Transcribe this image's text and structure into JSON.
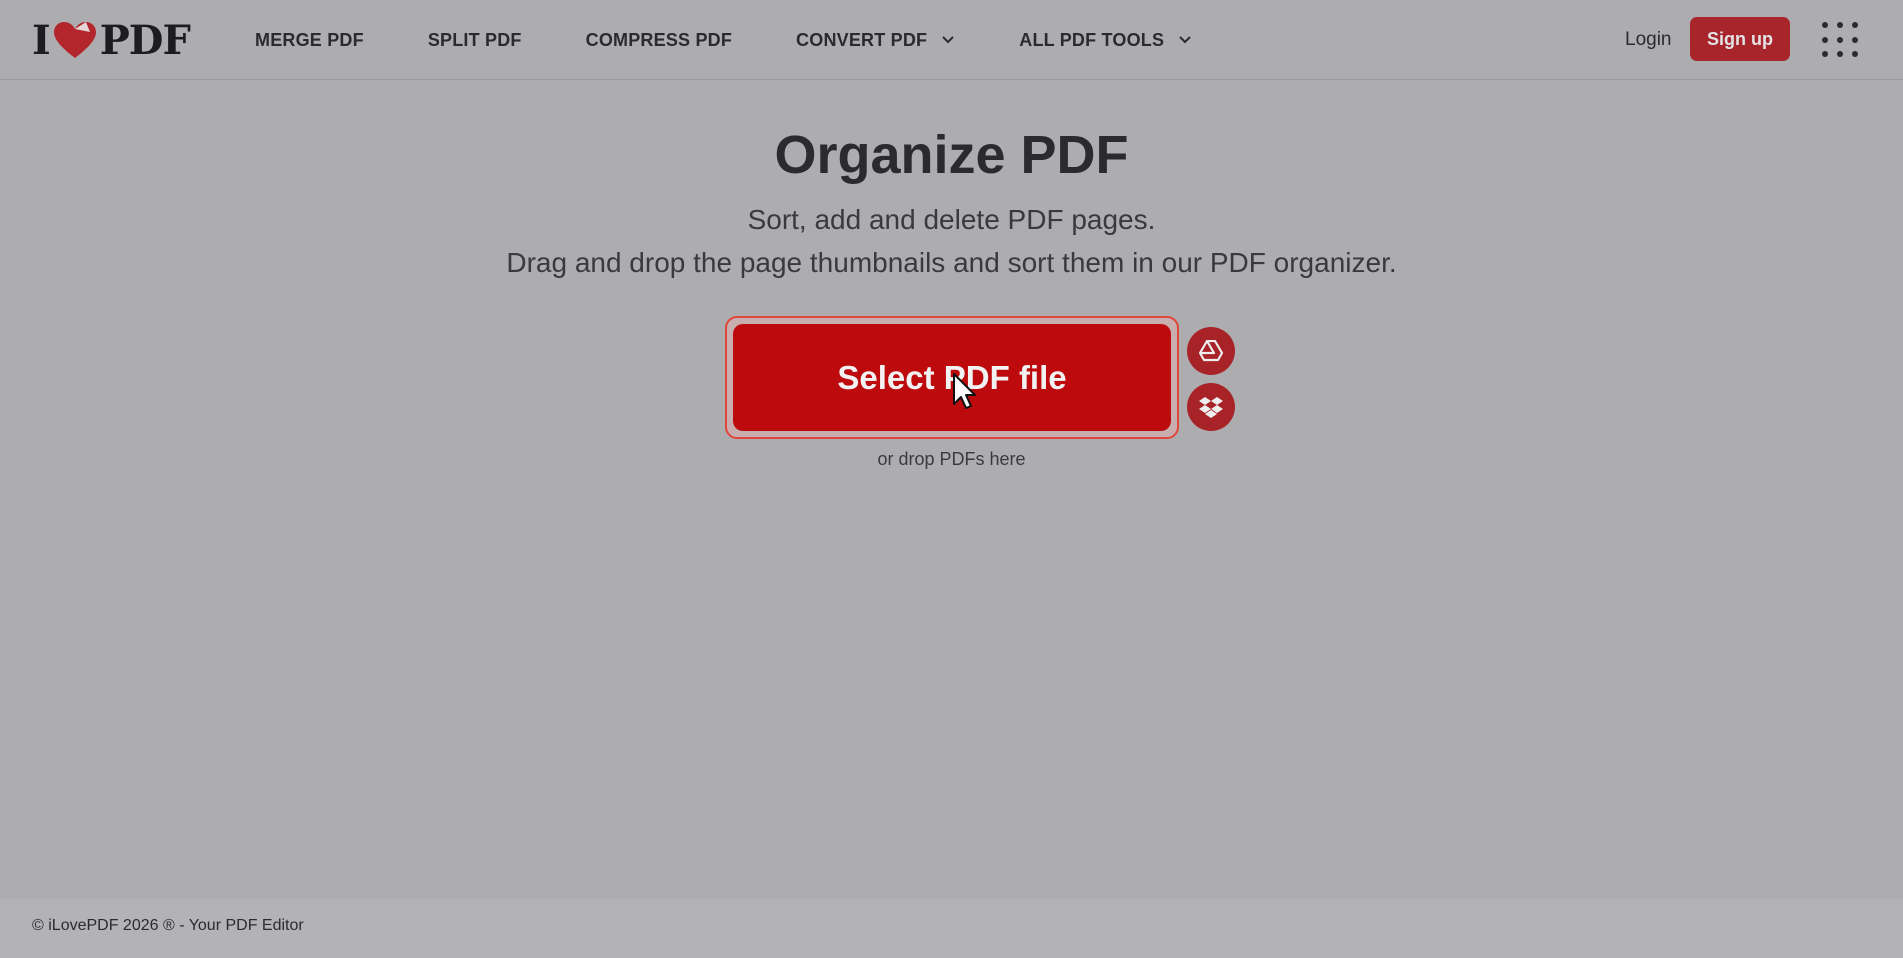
{
  "header": {
    "logo_left": "I",
    "logo_right": "PDF",
    "nav": [
      {
        "label": "MERGE PDF"
      },
      {
        "label": "SPLIT PDF"
      },
      {
        "label": "COMPRESS PDF"
      },
      {
        "label": "CONVERT PDF",
        "icon": "chevron-down-icon"
      },
      {
        "label": "ALL PDF TOOLS",
        "icon": "chevron-down-icon"
      }
    ],
    "login_label": "Login",
    "signup_label": "Sign up"
  },
  "main": {
    "title": "Organize PDF",
    "subtitle_line1": "Sort, add and delete PDF pages.",
    "subtitle_line2": "Drag and drop the page thumbnails and sort them in our PDF organizer.",
    "select_button_label": "Select PDF file",
    "drop_hint": "or drop PDFs here",
    "cloud_buttons": [
      {
        "icon": "google-drive-icon"
      },
      {
        "icon": "dropbox-icon"
      }
    ]
  },
  "footer": {
    "text": "© iLovePDF 2026 ® - Your PDF Editor"
  },
  "colors": {
    "brand_red": "#bd0a0d",
    "signup_red": "#a9252c",
    "background": "#adadaf"
  }
}
